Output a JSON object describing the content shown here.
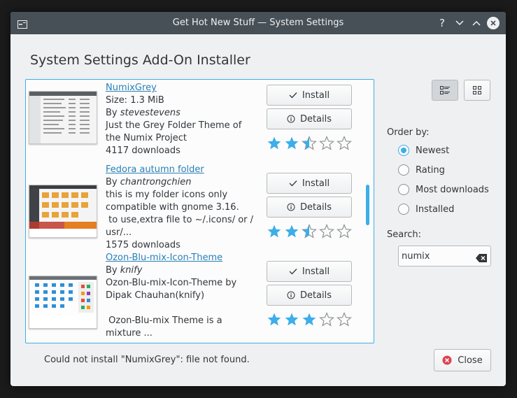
{
  "window": {
    "title": "Get Hot New Stuff — System Settings",
    "help_glyph": "?"
  },
  "heading": "System Settings Add-On Installer",
  "items": [
    {
      "name": "NumixGrey",
      "lines": [
        "Size: 1.3 MiB"
      ],
      "author_prefix": "By ",
      "author": "stevestevens",
      "description": [
        "Just the Grey Folder Theme of",
        "the Numix Project"
      ],
      "downloads": "4117 downloads",
      "install_label": "Install",
      "details_label": "Details",
      "rating": 2.5
    },
    {
      "name": "Fedora autumn folder",
      "lines": [],
      "author_prefix": "By ",
      "author": "chantrongchien",
      "description": [
        "this is my folder icons only",
        "compatible with gnome 3.16.",
        " to use,extra file to ~/.icons/ or /",
        "usr/..."
      ],
      "downloads": "1575 downloads",
      "install_label": "Install",
      "details_label": "Details",
      "rating": 2.5
    },
    {
      "name": "Ozon-Blu-mix-Icon-Theme",
      "lines": [],
      "author_prefix": "By ",
      "author": "knify",
      "description": [
        "Ozon-Blu-mix-Icon-Theme by",
        "Dipak Chauhan(knify)",
        "",
        " Ozon-Blu-mix Theme is a",
        "mixture ..."
      ],
      "downloads": "",
      "install_label": "Install",
      "details_label": "Details",
      "rating": 3
    }
  ],
  "sidebar": {
    "order_label": "Order by:",
    "order_options": [
      {
        "label": "Newest",
        "checked": true
      },
      {
        "label": "Rating",
        "checked": false
      },
      {
        "label": "Most downloads",
        "checked": false
      },
      {
        "label": "Installed",
        "checked": false
      }
    ],
    "search_label": "Search:",
    "search_value": "numix"
  },
  "status": "Could not install \"NumixGrey\": file not found.",
  "close_label": "Close",
  "colors": {
    "accent": "#3daee9",
    "titlebar": "#475057",
    "star_filled": "#3daee9",
    "star_empty": "#8e9194",
    "close_icon": "#da4453",
    "link": "#2980b9"
  },
  "icons": [
    "app-icon",
    "help-icon",
    "minimize-icon",
    "maximize-icon",
    "close-icon",
    "checkmark-icon",
    "info-icon",
    "star-icon",
    "list-view-icon",
    "grid-view-icon",
    "clear-text-icon",
    "dialog-close-icon"
  ]
}
